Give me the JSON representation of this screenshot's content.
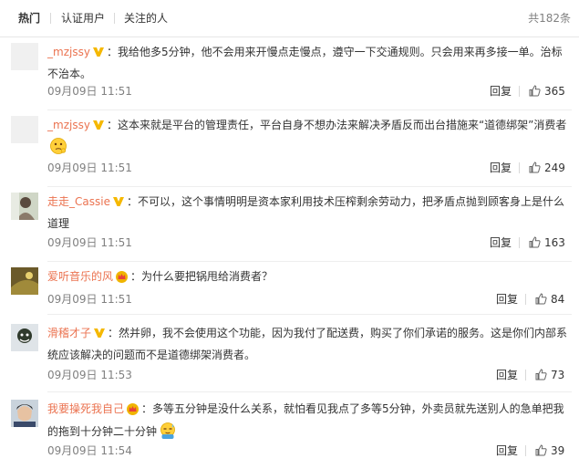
{
  "tabs": [
    {
      "label": "热门"
    },
    {
      "label": "认证用户"
    },
    {
      "label": "关注的人"
    }
  ],
  "total": "共182条",
  "accent": "#eb7350",
  "comments": [
    {
      "user": "_mzjssy",
      "badge": "gold-v-icon",
      "text": "：我给他多5分钟，他不会用来开慢点走慢点，遵守一下交通规则。只会用来再多接一单。治标不治本。",
      "time": "09月09日 11:51",
      "reply": "回复",
      "likes": "365"
    },
    {
      "user": "_mzjssy",
      "badge": "gold-v-icon",
      "text": "：这本来就是平台的管理责任，平台自身不想办法来解决矛盾反而出台措施来“道德绑架”消费者",
      "emoji": "thinking-face-icon",
      "time": "09月09日 11:51",
      "reply": "回复",
      "likes": "249"
    },
    {
      "user": "走走_Cassie",
      "badge": "gold-v-icon",
      "text": "：不可以，这个事情明明是资本家利用技术压榨剩余劳动力，把矛盾点抛到顾客身上是什么道理",
      "time": "09月09日 11:51",
      "reply": "回复",
      "likes": "163"
    },
    {
      "user": "爱听音乐的风",
      "badge": "crown-icon",
      "text": "：为什么要把锅甩给消费者？",
      "time": "09月09日 11:51",
      "reply": "回复",
      "likes": "84"
    },
    {
      "user": "滑稽才子",
      "badge": "gold-v-icon",
      "text": "：然并卵，我不会使用这个功能，因为我付了配送费，购买了你们承诺的服务。这是你们内部系统应该解决的问题而不是道德绑架消费者。",
      "time": "09月09日 11:53",
      "reply": "回复",
      "likes": "73"
    },
    {
      "user": "我要操死我自己",
      "badge": "crown-icon",
      "text": "：多等五分钟是没什么关系，就怕看见我点了多等5分钟，外卖员就先送别人的急单把我的拖到十分钟二十分钟",
      "emoji": "sweat-hug-face-icon",
      "time": "09月09日 11:54",
      "reply": "回复",
      "likes": "39"
    }
  ]
}
